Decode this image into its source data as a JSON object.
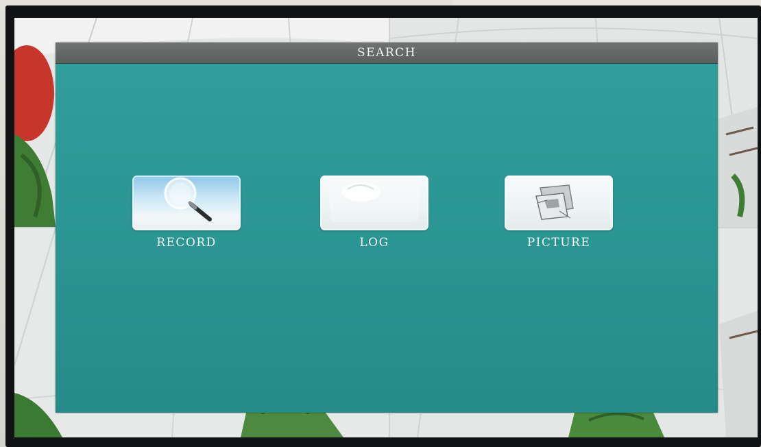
{
  "dialog": {
    "title": "SEARCH"
  },
  "options": [
    {
      "label": "RECORD",
      "icon": "magnifier-icon"
    },
    {
      "label": "LOG",
      "icon": "document-icon"
    },
    {
      "label": "PICTURE",
      "icon": "photos-icon"
    }
  ],
  "colors": {
    "dialog_background": "#2a9592",
    "title_bar": "#666a69",
    "tile_face": "#f4f8f8",
    "label_text": "#f4f7f7"
  }
}
